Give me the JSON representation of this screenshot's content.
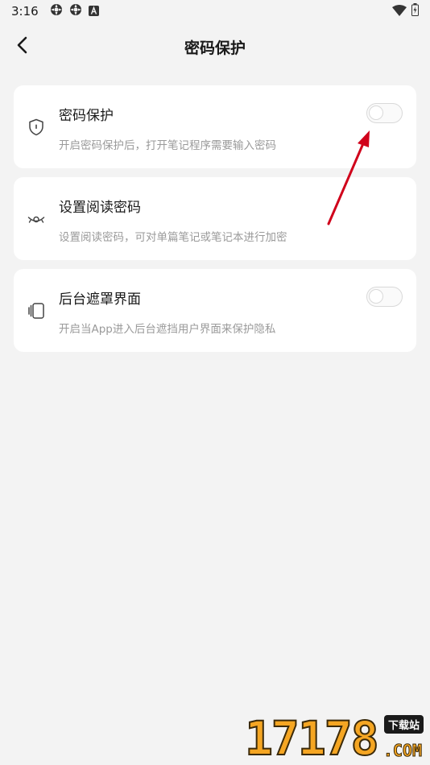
{
  "status_bar": {
    "time": "3:16",
    "left_icons": [
      "gear-icon",
      "gear-icon",
      "font-icon"
    ],
    "right_icons": [
      "wifi-icon",
      "battery-icon"
    ]
  },
  "header": {
    "back_icon": "chevron-left-icon",
    "title": "密码保护"
  },
  "cards": [
    {
      "icon": "shield-icon",
      "title": "密码保护",
      "description": "开启密码保护后，打开笔记程序需要输入密码",
      "toggle": {
        "enabled": false
      }
    },
    {
      "icon": "eye-icon",
      "title": "设置阅读密码",
      "description": "设置阅读密码，可对单篇笔记或笔记本进行加密"
    },
    {
      "icon": "phone-layers-icon",
      "title": "后台遮罩界面",
      "description": "开启当App进入后台遮挡用户界面来保护隐私",
      "toggle": {
        "enabled": false
      }
    }
  ],
  "annotation": {
    "type": "red-arrow",
    "color": "#d0021b",
    "points_to": "password-protect-toggle"
  },
  "watermark": {
    "digits": "17178",
    "badge": "下载站",
    "suffix": ".COM"
  }
}
